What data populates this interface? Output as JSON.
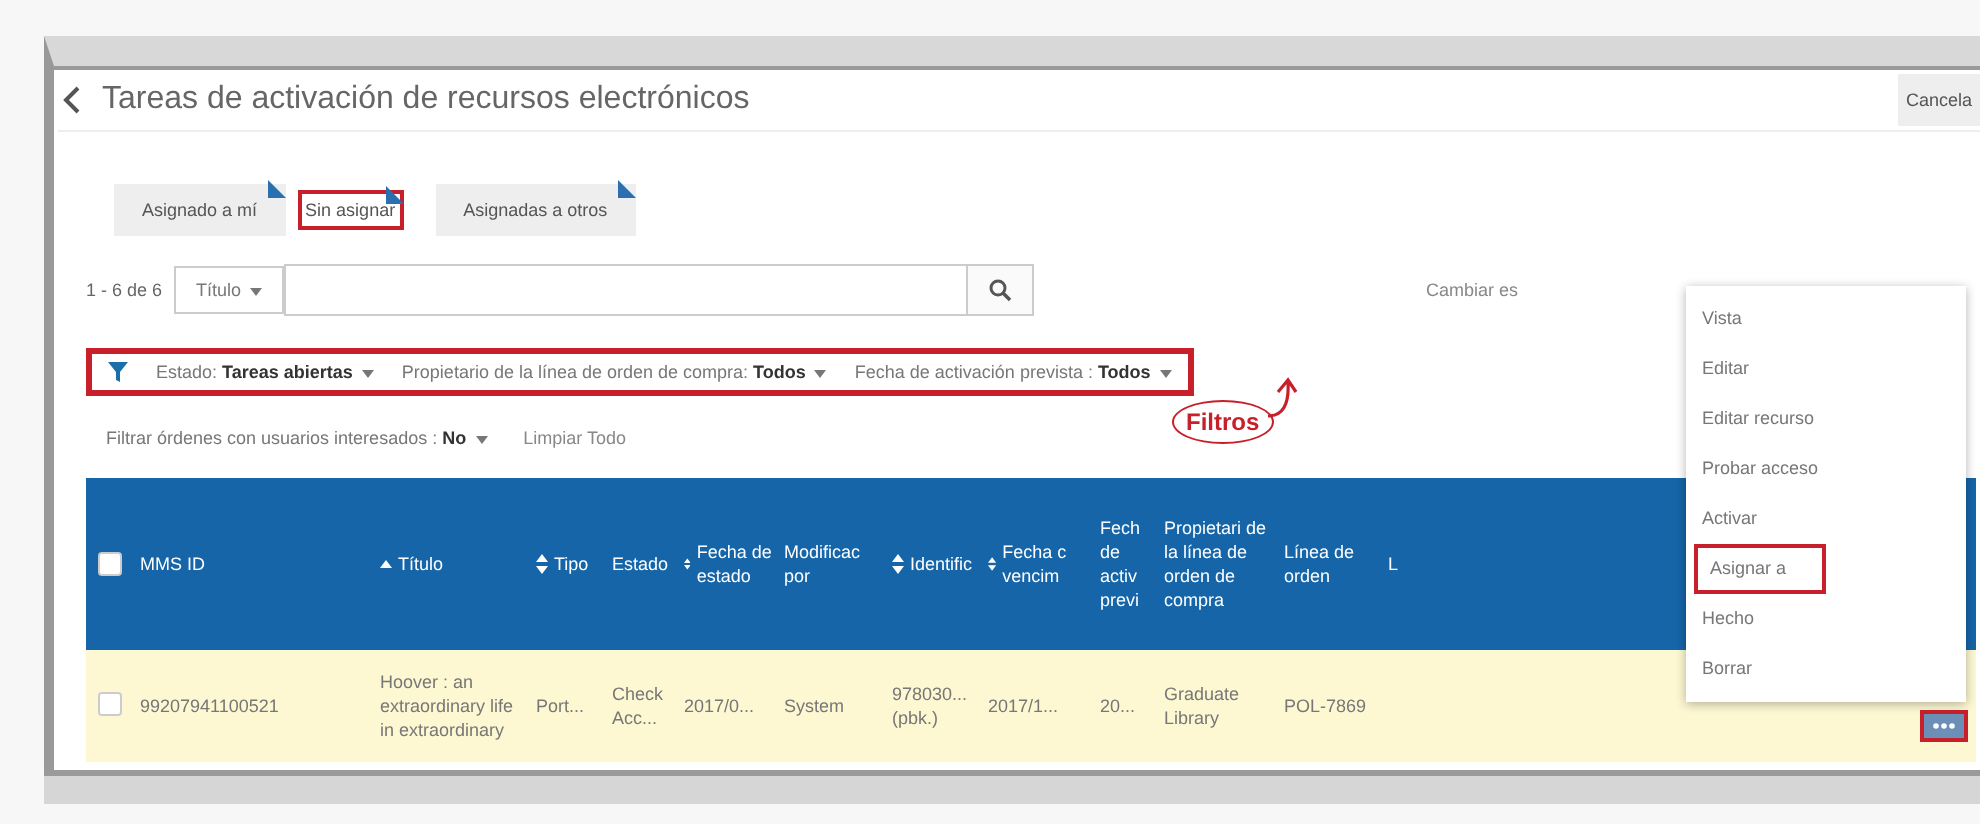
{
  "header": {
    "title": "Tareas de activación de recursos electrónicos",
    "cancel_button": "Cancela"
  },
  "tabs": [
    {
      "label": "Asignado a mí",
      "selected": false,
      "highlighted": false
    },
    {
      "label": "Sin asignar",
      "selected": true,
      "highlighted": true
    },
    {
      "label": "Asignadas a otros",
      "selected": false,
      "highlighted": false
    }
  ],
  "search": {
    "count": "1 - 6 de 6",
    "field_scope": "Título",
    "side_link": "Cambiar es"
  },
  "filters": {
    "highlighted": true,
    "items": [
      {
        "label": "Estado:",
        "value": "Tareas abiertas"
      },
      {
        "label": "Propietario de la línea de orden de compra:",
        "value": "Todos"
      },
      {
        "label": "Fecha de activación prevista :",
        "value": "Todos"
      }
    ]
  },
  "filters_2": {
    "label": "Filtrar órdenes con usuarios interesados :",
    "value": "No",
    "clear_link": "Limpiar Todo"
  },
  "annotation": {
    "label": "Filtros"
  },
  "table": {
    "all_checked": false,
    "columns": [
      {
        "label": "MMS ID",
        "sortable": false,
        "sorted": false
      },
      {
        "label": "Título",
        "sortable": true,
        "sorted": true
      },
      {
        "label": "Tipo",
        "sortable": true,
        "sorted": false
      },
      {
        "label": "Estado",
        "sortable": false,
        "sorted": false
      },
      {
        "label": "Fecha de estado",
        "sortable": true,
        "sorted": false
      },
      {
        "label": "Modificac por",
        "sortable": false,
        "sorted": false
      },
      {
        "label": "Identific",
        "sortable": true,
        "sorted": false
      },
      {
        "label": "Fecha c vencim",
        "sortable": true,
        "sorted": false
      },
      {
        "label": "Fech de activ previ",
        "sortable": false,
        "sorted": false
      },
      {
        "label": "Propietari de la línea de orden de compra",
        "sortable": false,
        "sorted": false
      },
      {
        "label": "Línea de orden",
        "sortable": false,
        "sorted": false
      },
      {
        "label": "L",
        "sortable": false,
        "sorted": false
      }
    ],
    "rows": [
      {
        "selected": true,
        "checked": false,
        "cells": [
          "99207941100521",
          "Hoover : an extraordinary life in extraordinary",
          "Port...",
          "Check Acc...",
          "2017/0...",
          "System",
          "978030... (pbk.)",
          "2017/1...",
          "20...",
          "Graduate Library",
          "POL-7869"
        ],
        "action_highlighted": true
      }
    ]
  },
  "menu": {
    "items": [
      {
        "label": "Vista",
        "highlighted": false
      },
      {
        "label": "Editar",
        "highlighted": false
      },
      {
        "label": "Editar recurso",
        "highlighted": false
      },
      {
        "label": "Probar acceso",
        "highlighted": false
      },
      {
        "label": "Activar",
        "highlighted": false
      },
      {
        "label": "Asignar a",
        "highlighted": true
      },
      {
        "label": "Hecho",
        "highlighted": false
      },
      {
        "label": "Borrar",
        "highlighted": false
      }
    ]
  }
}
